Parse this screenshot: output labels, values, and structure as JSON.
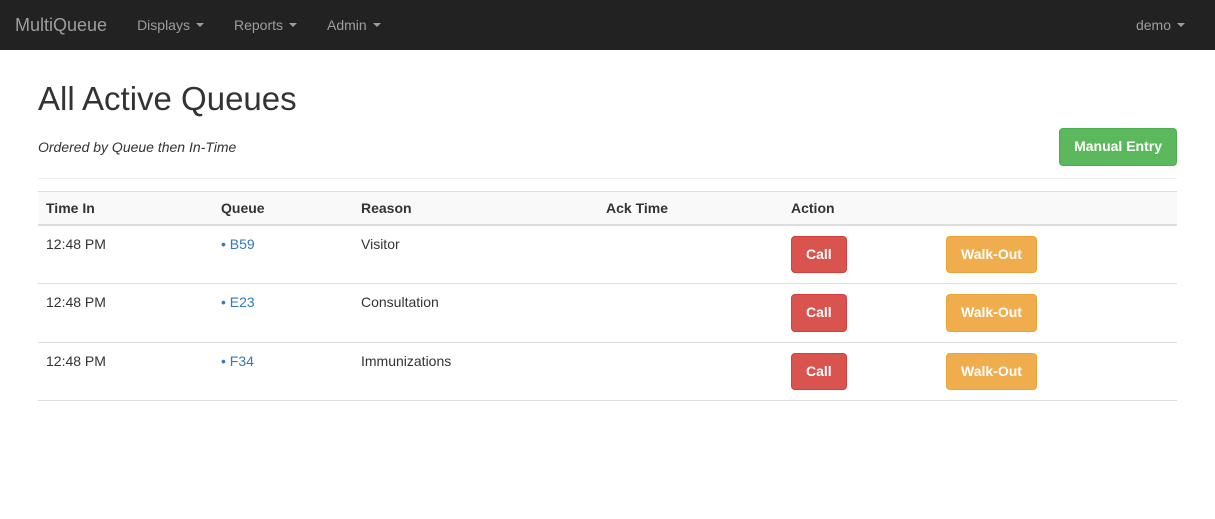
{
  "navbar": {
    "brand": "MultiQueue",
    "items": [
      "Displays",
      "Reports",
      "Admin"
    ],
    "user": "demo"
  },
  "page": {
    "title": "All Active Queues",
    "subtitle": "Ordered by Queue then In-Time",
    "manual_entry_label": "Manual Entry"
  },
  "table": {
    "headers": {
      "time_in": "Time In",
      "queue": "Queue",
      "reason": "Reason",
      "ack_time": "Ack Time",
      "action": "Action"
    },
    "call_label": "Call",
    "walkout_label": "Walk-Out",
    "rows": [
      {
        "time_in": "12:48 PM",
        "queue": "B59",
        "reason": "Visitor",
        "ack_time": ""
      },
      {
        "time_in": "12:48 PM",
        "queue": "E23",
        "reason": "Consultation",
        "ack_time": ""
      },
      {
        "time_in": "12:48 PM",
        "queue": "F34",
        "reason": "Immunizations",
        "ack_time": ""
      }
    ]
  }
}
